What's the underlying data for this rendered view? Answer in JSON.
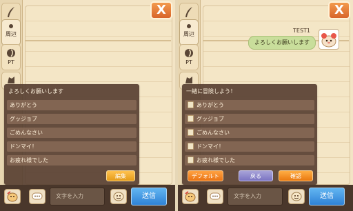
{
  "colors": {
    "accent_orange": "#e9780f",
    "send_blue": "#2f82d6",
    "back_purple": "#7a73c2",
    "bubble_green": "#c9de9b",
    "popup_brown": "#584032"
  },
  "left": {
    "close_label": "X",
    "tabs": [
      {
        "icon": "quill-icon",
        "label": ""
      },
      {
        "icon": "nearby-icon",
        "label": "周辺"
      },
      {
        "icon": "party-icon",
        "label": "PT"
      },
      {
        "icon": "guild-icon",
        "label": ""
      }
    ],
    "popup": {
      "header": "よろしくお願いします",
      "phrases": [
        "ありがとう",
        "グッジョブ",
        "ごめんなさい",
        "ドンマイ！",
        "お疲れ様でした"
      ],
      "edit_label": "編集"
    },
    "bottom": {
      "input_placeholder": "文字を入力",
      "send_label": "送信"
    }
  },
  "right": {
    "close_label": "X",
    "tabs": [
      {
        "icon": "quill-icon",
        "label": ""
      },
      {
        "icon": "nearby-icon",
        "label": "周辺"
      },
      {
        "icon": "party-icon",
        "label": "PT"
      },
      {
        "icon": "guild-icon",
        "label": ""
      }
    ],
    "message": {
      "sender": "TEST1",
      "text": "よろしくお願いします"
    },
    "popup": {
      "header": "一緒に冒険しよう！",
      "phrases": [
        "ありがとう",
        "グッジョブ",
        "ごめんなさい",
        "ドンマイ！",
        "お疲れ様でした"
      ],
      "default_label": "デフォルト",
      "back_label": "戻る",
      "confirm_label": "確認"
    },
    "bottom": {
      "input_placeholder": "文字を入力",
      "send_label": "送信"
    }
  }
}
